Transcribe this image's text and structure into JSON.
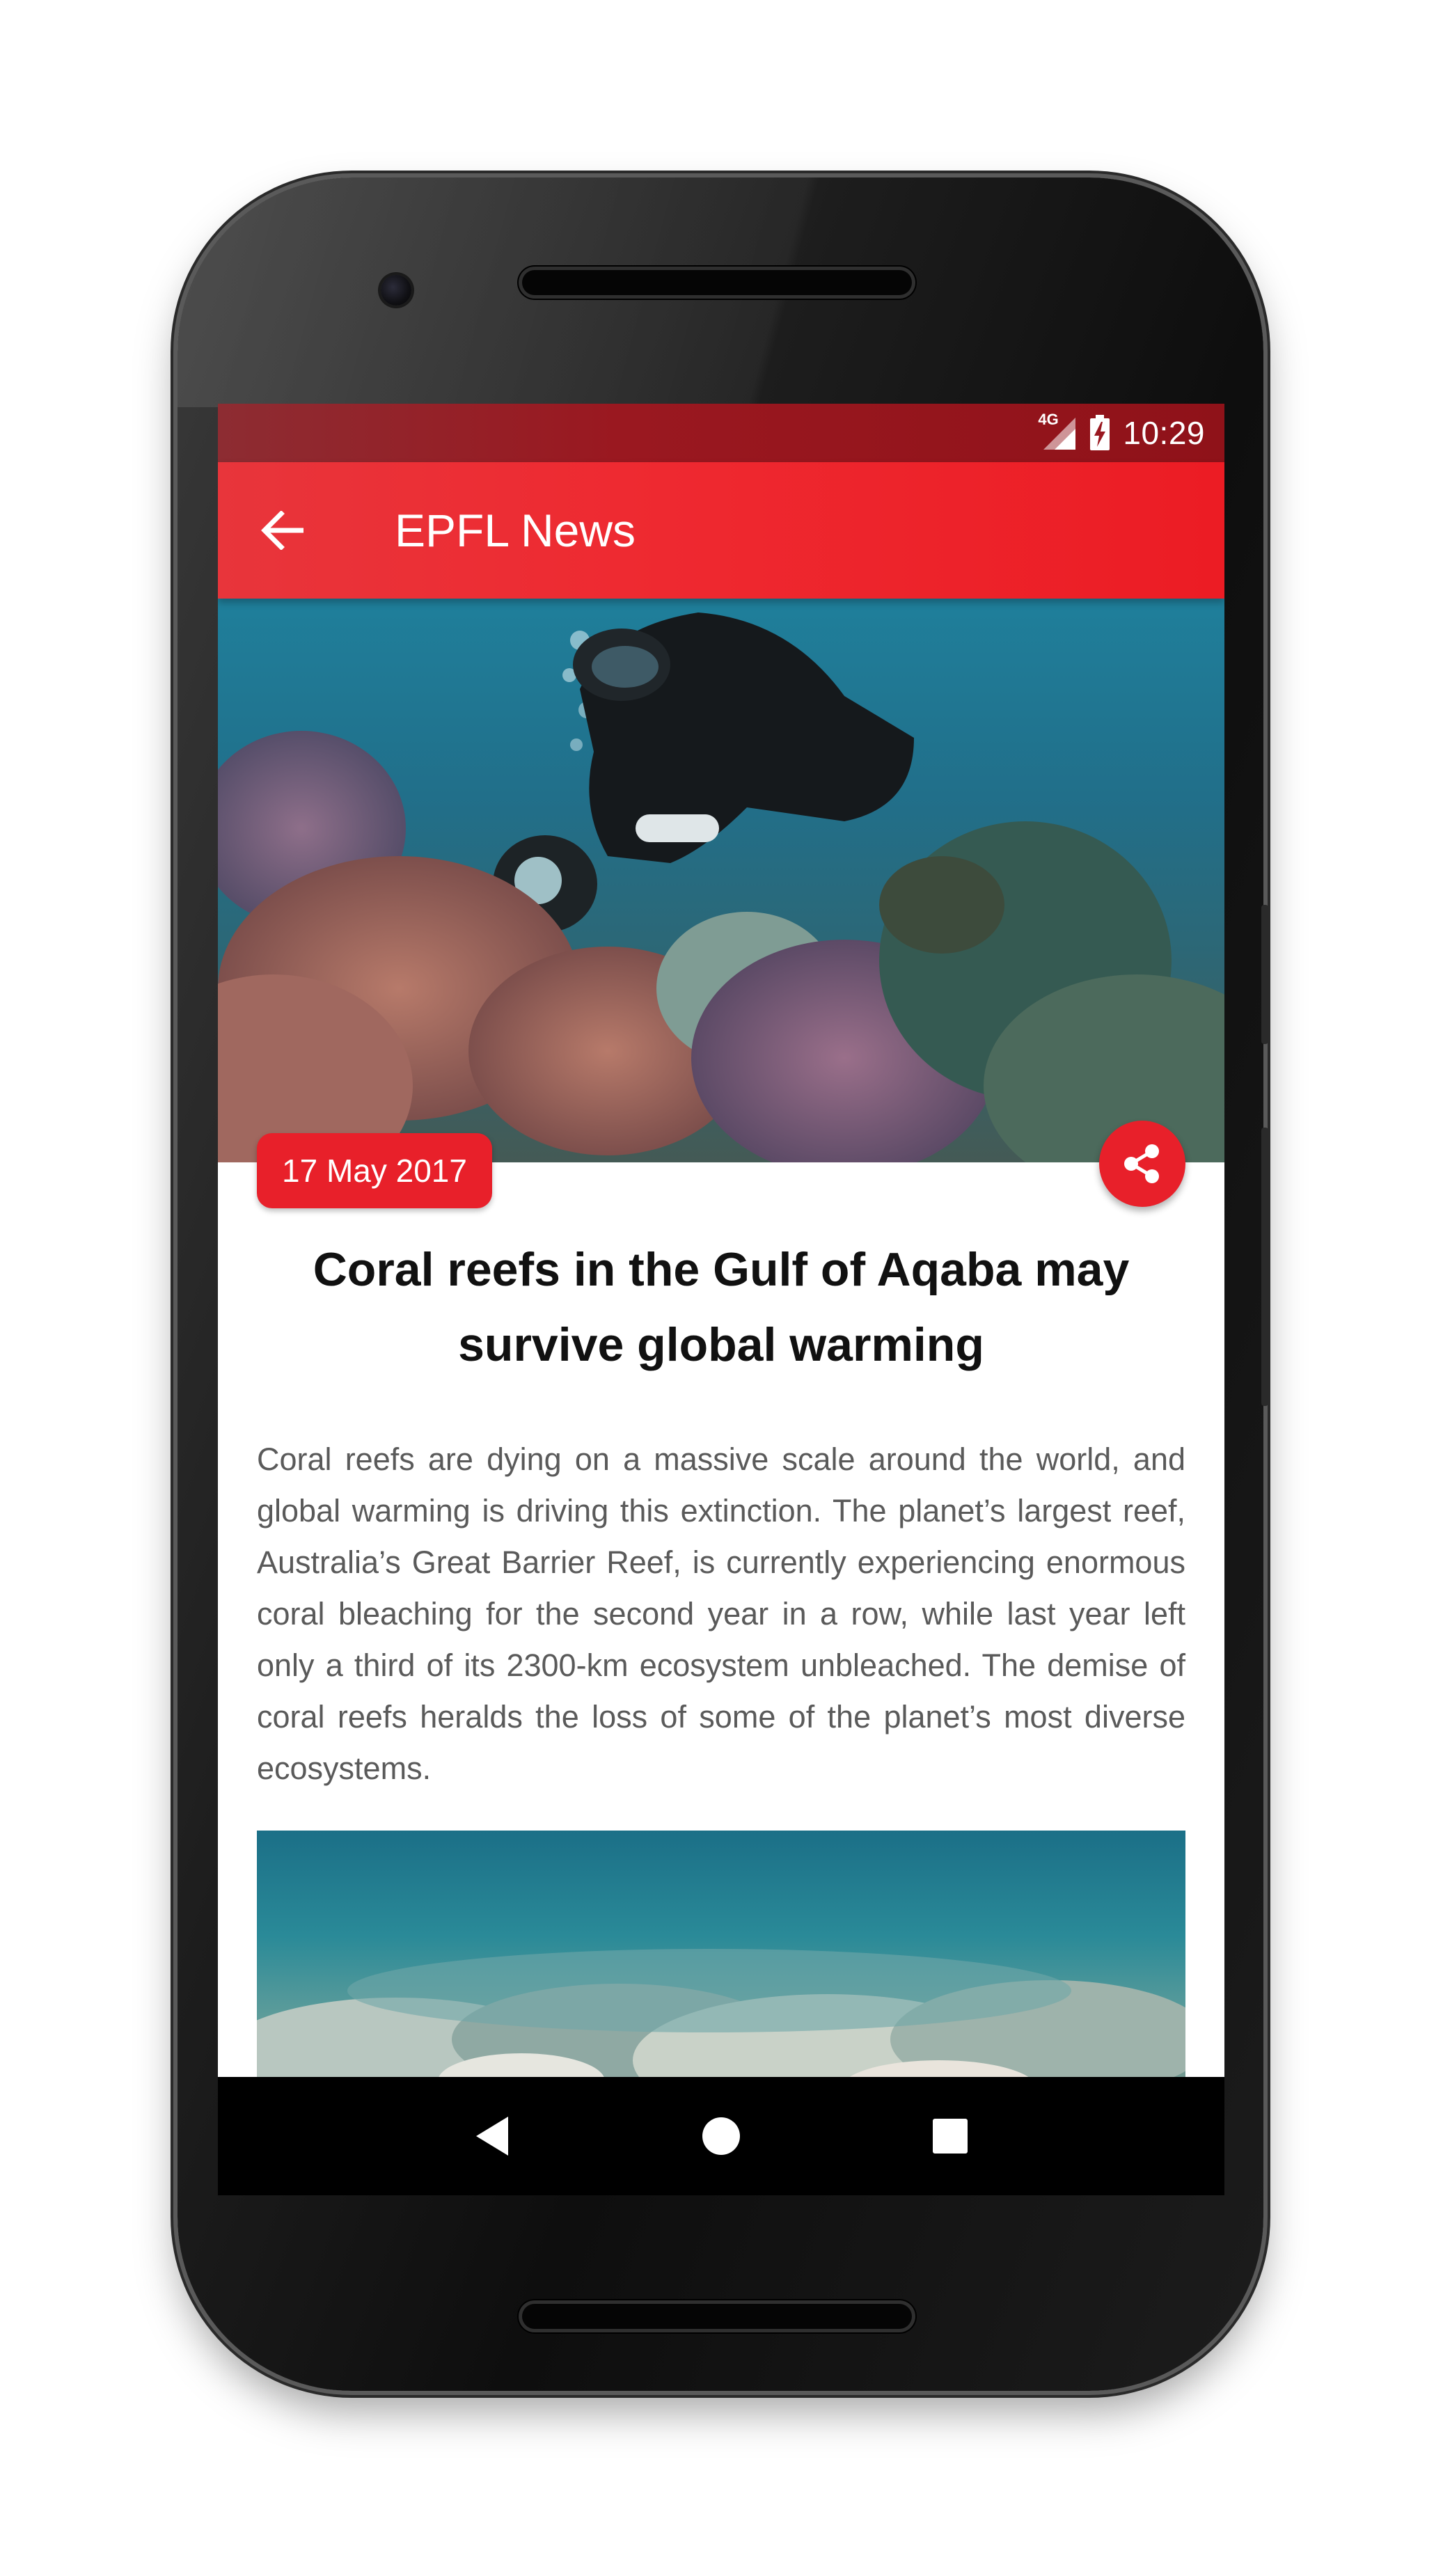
{
  "status_bar": {
    "network": "4G",
    "time": "10:29"
  },
  "app_bar": {
    "title": "EPFL News",
    "back_icon": "arrow-back-icon"
  },
  "article": {
    "date": "17 May 2017",
    "title": "Coral reefs in the Gulf of Aqaba may survive global warming",
    "body": "Coral reefs are dying on a massive scale around the world, and global warming is driving this extinction. The planet’s largest reef, Australia’s Great Barrier Reef, is currently experiencing enormous coral bleaching for the second year in a row, while last year left only a third of its 2300-km ecosystem unbleached. The demise of coral reefs heralds the loss of some of the planet’s most diverse ecosystems.",
    "share_icon": "share-icon"
  },
  "nav": {
    "back_icon": "nav-back-triangle-icon",
    "home_icon": "nav-home-circle-icon",
    "recents_icon": "nav-recents-square-icon"
  },
  "colors": {
    "accent": "#ec1c24",
    "status_bar": "#9a1820",
    "body_text": "#5a5a5a",
    "title_text": "#111111"
  }
}
